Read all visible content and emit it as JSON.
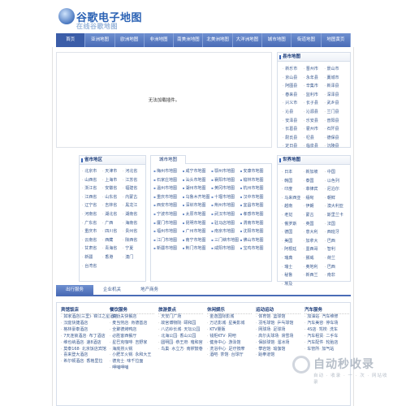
{
  "header": {
    "logo_title": "谷歌电子地图",
    "logo_sub": "在线谷歌地图"
  },
  "nav": [
    "首页",
    "亚洲地图",
    "欧洲地图",
    "非洲地图",
    "南美洲地图",
    "北美洲地图",
    "大洋洲地图",
    "城市地图",
    "街道地图",
    "地图黄页"
  ],
  "plugin": {
    "message": "无法加载插件。"
  },
  "county_panel": {
    "title": "县市地图",
    "items": [
      "新乐市",
      "晋州市",
      "景山市",
      "京山县",
      "永年县",
      "藁城市",
      "阿图县",
      "辛集市",
      "新泽县",
      "春来县",
      "监利市",
      "深泽县",
      "兴义市",
      "长子县",
      "武乡县",
      "沁县",
      "沁源县",
      "兰门县",
      "安泽县",
      "乐安县",
      "普阳县",
      "长葛县",
      "霍州市",
      "石阡县",
      "尉氏县",
      "杞县",
      "德保县",
      "定日县",
      "临泉县",
      "沅陵县"
    ]
  },
  "province_panel": {
    "title": "省市地区",
    "items": [
      "北京市",
      "天津市",
      "河北省",
      "山西省",
      "上海市",
      "江苏省",
      "浙江省",
      "安徽省",
      "福建省",
      "江西省",
      "山东省",
      "内蒙古",
      "辽宁省",
      "吉林省",
      "黑龙江",
      "河南省",
      "湖北省",
      "湖南省",
      "广东省",
      "广西",
      "海南省",
      "重庆市",
      "四川省",
      "贵州省",
      "云南省",
      "西藏",
      "陕西省",
      "甘肃省",
      "青海省",
      "宁夏",
      "新疆",
      "香港",
      "澳门",
      "台湾省"
    ]
  },
  "city_panel": {
    "title": "城市地图",
    "items": [
      "梅州市地图",
      "咸宁市地图",
      "鄂州市地图",
      "安康市地图",
      "石家庄地图",
      "汕头市地图",
      "襄阳市地图",
      "榆林市地图",
      "温州市地图",
      "湖州市地图",
      "黄冈市地图",
      "杭州市地图",
      "重庆市地图",
      "乌鲁木齐地图",
      "十堰市地图",
      "汉中市地图",
      "西安市地图",
      "深圳市地图",
      "荆州市地图",
      "宜昌市地图",
      "宁波市地图",
      "太原市地图",
      "武汉市地图",
      "孝感市地图",
      "厦门市地图",
      "昆明市地图",
      "驻马店地图",
      "渭南市地图",
      "福州市地图",
      "广州市地图",
      "南京市地图",
      "沈阳市地图",
      "江门市地图",
      "南宁市地图",
      "三门峡市地图",
      "佛山市地图",
      "新疆市地图",
      "荆门市地图",
      "咸阳市地图",
      "宝鸡市地图"
    ]
  },
  "world_panel": {
    "title": "世界地图",
    "items": [
      "日本",
      "新加坡",
      "中国",
      "韩国",
      "泰国",
      "以色列",
      "印度",
      "菲律宾",
      "尼泊尔",
      "马来西亚",
      "缅甸",
      "朝鲜",
      "越南",
      "伊朗",
      "澳大利亚",
      "老挝",
      "蒙古",
      "斯里兰卡",
      "俄罗斯",
      "英国",
      "法国",
      "德国",
      "意大利",
      "西班牙",
      "美国",
      "加拿大",
      "巴西",
      "阿根廷",
      "墨西哥",
      "智利",
      "瑞典",
      "挪威",
      "荷兰",
      "瑞士",
      "奥地利",
      "巴西",
      "秘鲁",
      "新西兰",
      "南非",
      "埃及"
    ]
  },
  "bottom_tabs": [
    "出行服务",
    "企业机关",
    "地产商务"
  ],
  "columns": [
    {
      "title": "宾馆饭店",
      "items": [
        "如家酒店(三里)",
        "锦江之星酒店",
        "汉庭快捷酒店",
        "格林豪泰酒店",
        "7天连锁酒店",
        "布丁酒店",
        "维也纳酒店",
        "速8酒店",
        "莫泰168",
        "北京饭店宾馆",
        "喜来登大酒店",
        "希尔顿酒店",
        "香格里拉"
      ]
    },
    {
      "title": "餐饮服务",
      "items": [
        "真功夫快餐店",
        "麦当劳店",
        "肯德基店",
        "全聚德烤鸭店",
        "必胜客西餐厅",
        "星巴克咖啡",
        "吉野家",
        "海底捞火锅",
        "小肥羊火锅",
        "永和大王",
        "德克士",
        "味千拉面",
        "呷哺呷哺"
      ]
    },
    {
      "title": "旅游景点",
      "items": [
        "天安门广场",
        "故宫博物院",
        "颐和园",
        "八达岭长城",
        "天坛公园",
        "北海公园",
        "香山公园",
        "圆明园",
        "恭王府",
        "雍和宫",
        "鸟巢",
        "水立方",
        "南锣鼓巷"
      ]
    },
    {
      "title": "休闲娱乐",
      "items": [
        "金逸国际影城",
        "万达影城",
        "星美影城",
        "KTV量贩",
        "钱柜KTV",
        "网吧",
        "健身中心",
        "游泳馆",
        "洗浴中心",
        "足疗按摩",
        "酒吧",
        "茶馆",
        "台球厅"
      ]
    },
    {
      "title": "运动运动",
      "items": [
        "体育馆",
        "篮球馆",
        "羽毛球馆",
        "乒乓球馆",
        "网球场",
        "足球场",
        "高尔夫球场",
        "滑雪场",
        "保龄球馆",
        "溜冰场",
        "攀岩馆",
        "瑜伽馆",
        "跆拳道馆"
      ]
    },
    {
      "title": "汽车服务",
      "items": [
        "加油站",
        "汽车维修",
        "汽车美容",
        "停车场",
        "4S店",
        "驾校",
        "洗车",
        "汽车租赁",
        "二手车",
        "汽车配件",
        "轮胎店",
        "车管所",
        "加气站"
      ]
    }
  ],
  "watermark": {
    "text": "自动秒收录",
    "sub": "自动 · 收录 · 一 · 次 · 网站收录"
  }
}
